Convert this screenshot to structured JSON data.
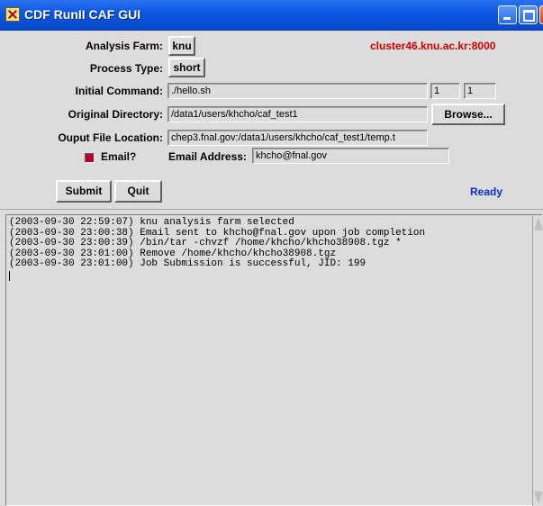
{
  "window": {
    "title": "CDF RunII CAF GUI"
  },
  "form": {
    "analysis_farm_label": "Analysis Farm:",
    "analysis_farm_value": "knu",
    "server": "cluster46.knu.ac.kr:8000",
    "process_type_label": "Process Type:",
    "process_type_value": "short",
    "initial_command_label": "Initial Command:",
    "initial_command_value": "./hello.sh",
    "segment_start": "1",
    "segment_end": "1",
    "original_directory_label": "Original Directory:",
    "original_directory_value": "/data1/users/khcho/caf_test1",
    "browse_label": "Browse...",
    "output_location_label": "Ouput File Location:",
    "output_location_value": "chep3.fnal.gov:/data1/users/khcho/caf_test1/temp.t",
    "email_toggle_label": "Email?",
    "email_address_label": "Email Address:",
    "email_address_value": "khcho@fnal.gov",
    "submit_label": "Submit",
    "quit_label": "Quit",
    "status": "Ready"
  },
  "log": {
    "lines": [
      "(2003-09-30 22:59:07) knu analysis farm selected",
      "(2003-09-30 23:00:38) Email sent to khcho@fnal.gov upon job completion",
      "(2003-09-30 23:00:39) /bin/tar -chvzf /home/khcho/khcho38908.tgz *",
      "(2003-09-30 23:01:00) Remove /home/khcho/khcho38908.tgz",
      "(2003-09-30 23:01:00) Job Submission is successful, JID: 199"
    ]
  },
  "colors": {
    "titlebar": "#0a56e0",
    "server_text": "#d40000",
    "status_text": "#0a2fd0",
    "checkbox_indicator": "#b8002a"
  }
}
